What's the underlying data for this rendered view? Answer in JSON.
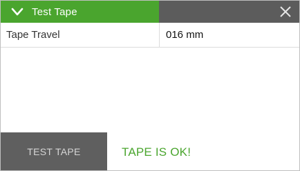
{
  "header": {
    "title": "Test Tape",
    "expand_icon": "chevron-down-icon",
    "close_icon": "close-icon",
    "accent_color": "#4aa52e",
    "bar_color": "#5c5c5c"
  },
  "fields": [
    {
      "label": "Tape Travel",
      "value": "016 mm"
    }
  ],
  "actions": {
    "test_button_label": "TEST TAPE"
  },
  "status": {
    "text": "TAPE IS OK!",
    "color": "#4aa52e"
  }
}
